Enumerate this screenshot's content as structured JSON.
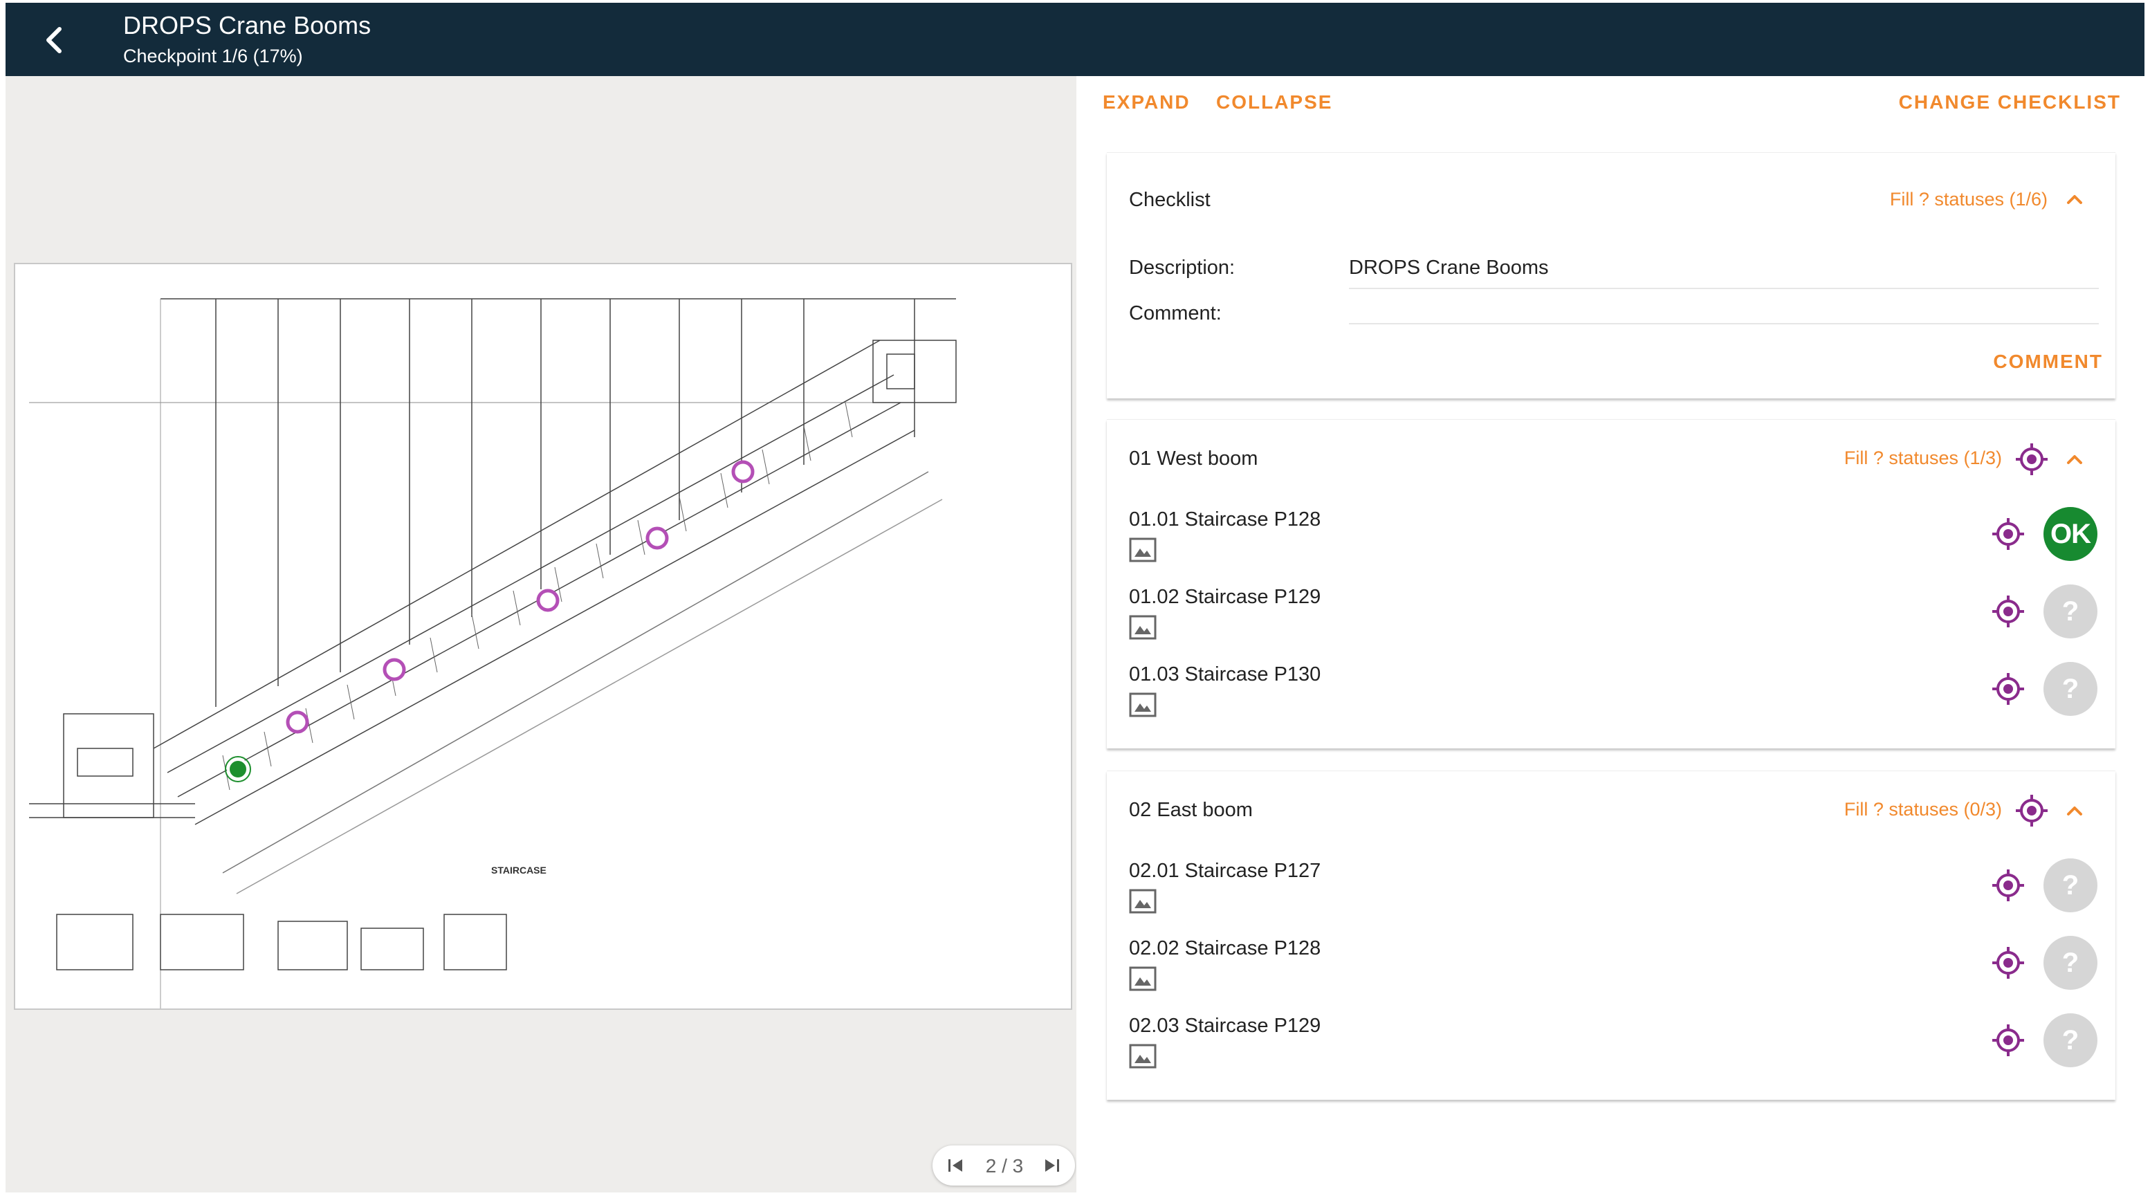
{
  "header": {
    "title": "DROPS Crane Booms",
    "subtitle": "Checkpoint 1/6 (17%)"
  },
  "viewer": {
    "page_label": "2 / 3",
    "drawing_caption": "STAIRCASE"
  },
  "toolbar": {
    "expand_label": "EXPAND",
    "collapse_label": "COLLAPSE",
    "change_checklist_label": "CHANGE CHECKLIST"
  },
  "checklist": {
    "title": "Checklist",
    "fill_status": "Fill ? statuses (1/6)",
    "description_label": "Description:",
    "description_value": "DROPS Crane Booms",
    "comment_label": "Comment:",
    "comment_value": "",
    "comment_button": "COMMENT"
  },
  "groups": [
    {
      "title": "01 West boom",
      "fill_status": "Fill ? statuses (1/3)",
      "items": [
        {
          "label": "01.01 Staircase P128",
          "status": "OK"
        },
        {
          "label": "01.02 Staircase P129",
          "status": "?"
        },
        {
          "label": "01.03 Staircase P130",
          "status": "?"
        }
      ]
    },
    {
      "title": "02 East boom",
      "fill_status": "Fill ? statuses (0/3)",
      "items": [
        {
          "label": "02.01 Staircase P127",
          "status": "?"
        },
        {
          "label": "02.02 Staircase P128",
          "status": "?"
        },
        {
          "label": "02.03 Staircase P129",
          "status": "?"
        }
      ]
    }
  ],
  "icons": {
    "back": "back-arrow-icon",
    "target": "crosshair-target-icon",
    "chevron": "chevron-up-icon",
    "image": "image-icon",
    "first_page": "first-page-icon",
    "last_page": "last-page-icon"
  },
  "colors": {
    "header_bg": "#132b3b",
    "accent_orange": "#f1892d",
    "target_purple": "#8a2b8c",
    "status_ok_green": "#178a30",
    "status_unset_gray": "#d6d6d6",
    "viewer_bg": "#eeedeb"
  }
}
